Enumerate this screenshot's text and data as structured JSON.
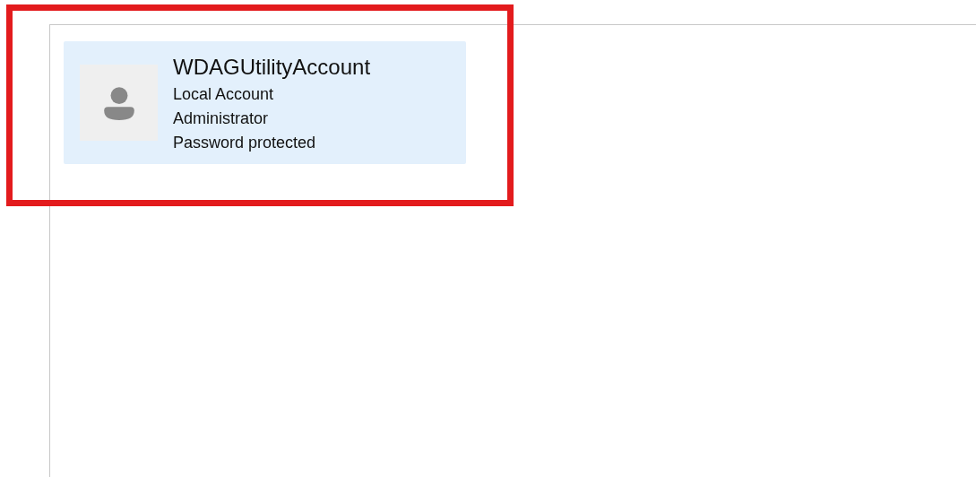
{
  "accounts": [
    {
      "name": "WDAGUtilityAccount",
      "details": [
        "Local Account",
        "Administrator",
        "Password protected"
      ],
      "selected": true
    }
  ],
  "highlight": {
    "color": "#e31b1d"
  }
}
